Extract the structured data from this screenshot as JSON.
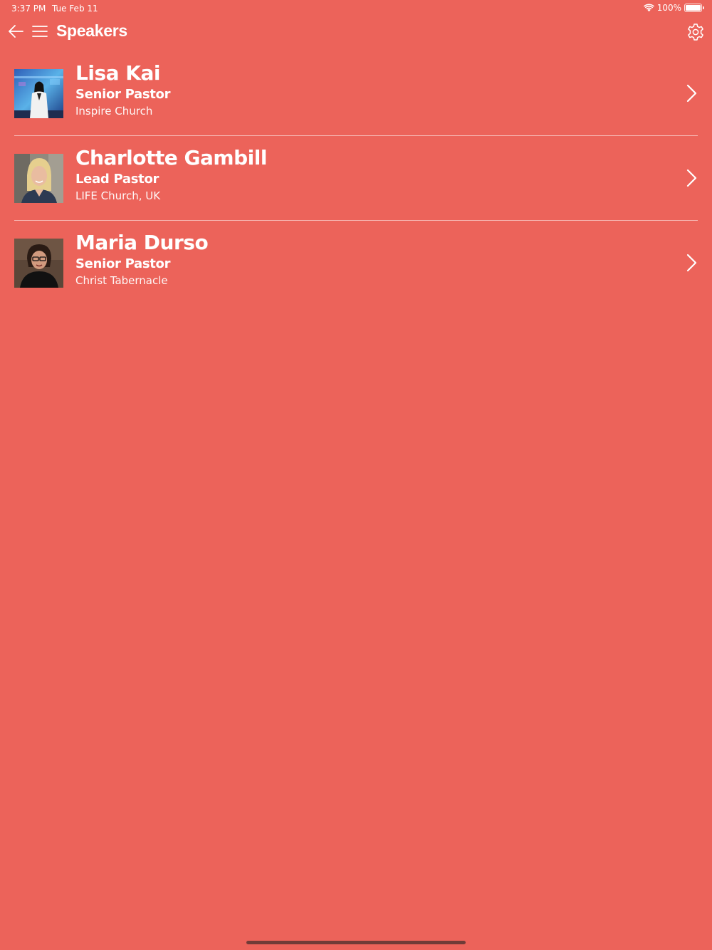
{
  "status_bar": {
    "time": "3:37 PM",
    "date": "Tue Feb 11",
    "battery": "100%"
  },
  "nav": {
    "title": "Speakers",
    "back_icon": "arrow-left-icon",
    "menu_icon": "hamburger-menu-icon",
    "settings_icon": "gear-icon"
  },
  "speakers": [
    {
      "name": "Lisa Kai",
      "title": "Senior Pastor",
      "church": "Inspire Church"
    },
    {
      "name": "Charlotte Gambill",
      "title": "Lead Pastor",
      "church": "LIFE Church, UK"
    },
    {
      "name": "Maria Durso",
      "title": "Senior Pastor",
      "church": "Christ Tabernacle"
    }
  ],
  "colors": {
    "background": "#EC635A",
    "text": "#FFFFFF"
  }
}
